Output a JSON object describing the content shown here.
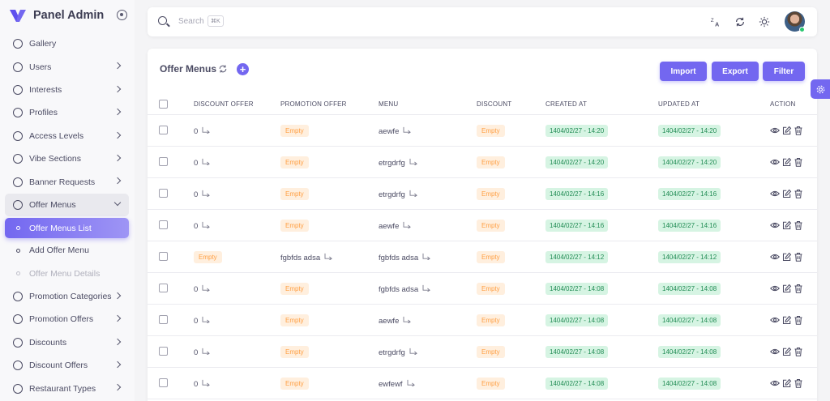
{
  "brand": {
    "title": "Panel Admin",
    "logo_color": "#7367f0"
  },
  "sidebar": {
    "items": [
      {
        "label": "Gallery",
        "chevron": false
      },
      {
        "label": "Users",
        "chevron": true
      },
      {
        "label": "Interests",
        "chevron": true
      },
      {
        "label": "Profiles",
        "chevron": true
      },
      {
        "label": "Access Levels",
        "chevron": true
      },
      {
        "label": "Vibe Sections",
        "chevron": true
      },
      {
        "label": "Banner Requests",
        "chevron": true
      },
      {
        "label": "Offer Menus",
        "chevron": true,
        "open": true
      },
      {
        "label": "Offer Menus List",
        "sub": true,
        "active": true
      },
      {
        "label": "Add Offer Menu",
        "sub": true
      },
      {
        "label": "Offer Menu Details",
        "sub": true,
        "disabled": true
      },
      {
        "label": "Promotion Categories",
        "chevron": true
      },
      {
        "label": "Promotion Offers",
        "chevron": true
      },
      {
        "label": "Discounts",
        "chevron": true
      },
      {
        "label": "Discount Offers",
        "chevron": true
      },
      {
        "label": "Restaurant Types",
        "chevron": true
      }
    ]
  },
  "topbar": {
    "search_placeholder": "Search",
    "shortcut": "⌘K",
    "icons": [
      "translate-icon",
      "refresh-icon",
      "sun-icon"
    ]
  },
  "page": {
    "title": "Offer Menus",
    "buttons": {
      "import": "Import",
      "export": "Export",
      "filter": "Filter"
    }
  },
  "table": {
    "columns": [
      "DISCOUNT OFFER",
      "PROMOTION OFFER",
      "MENU",
      "DISCOUNT",
      "CREATED AT",
      "UPDATED AT",
      "ACTION"
    ],
    "rows": [
      {
        "discount_offer": "0",
        "promotion_offer": "Empty",
        "menu": "aewfe",
        "discount": "Empty",
        "created": "1404/02/27 - 14:20",
        "updated": "1404/02/27 - 14:20"
      },
      {
        "discount_offer": "0",
        "promotion_offer": "Empty",
        "menu": "etrgdrfg",
        "discount": "Empty",
        "created": "1404/02/27 - 14:20",
        "updated": "1404/02/27 - 14:20"
      },
      {
        "discount_offer": "0",
        "promotion_offer": "Empty",
        "menu": "etrgdrfg",
        "discount": "Empty",
        "created": "1404/02/27 - 14:16",
        "updated": "1404/02/27 - 14:16"
      },
      {
        "discount_offer": "0",
        "promotion_offer": "Empty",
        "menu": "aewfe",
        "discount": "Empty",
        "created": "1404/02/27 - 14:16",
        "updated": "1404/02/27 - 14:16"
      },
      {
        "discount_offer": "Empty",
        "promotion_offer": "fgbfds adsa",
        "menu": "fgbfds adsa",
        "discount": "Empty",
        "created": "1404/02/27 - 14:12",
        "updated": "1404/02/27 - 14:12"
      },
      {
        "discount_offer": "0",
        "promotion_offer": "Empty",
        "menu": "fgbfds adsa",
        "discount": "Empty",
        "created": "1404/02/27 - 14:08",
        "updated": "1404/02/27 - 14:08"
      },
      {
        "discount_offer": "0",
        "promotion_offer": "Empty",
        "menu": "aewfe",
        "discount": "Empty",
        "created": "1404/02/27 - 14:08",
        "updated": "1404/02/27 - 14:08"
      },
      {
        "discount_offer": "0",
        "promotion_offer": "Empty",
        "menu": "etrgdrfg",
        "discount": "Empty",
        "created": "1404/02/27 - 14:08",
        "updated": "1404/02/27 - 14:08"
      },
      {
        "discount_offer": "0",
        "promotion_offer": "Empty",
        "menu": "ewfewf",
        "discount": "Empty",
        "created": "1404/02/27 - 14:08",
        "updated": "1404/02/27 - 14:08"
      }
    ]
  },
  "colors": {
    "primary": "#7367f0",
    "empty_badge_text": "#ff9f43",
    "empty_badge_bg": "#ffefde",
    "date_badge_text": "#218c54",
    "date_badge_bg": "#d6f4e3",
    "online": "#28c76f"
  }
}
